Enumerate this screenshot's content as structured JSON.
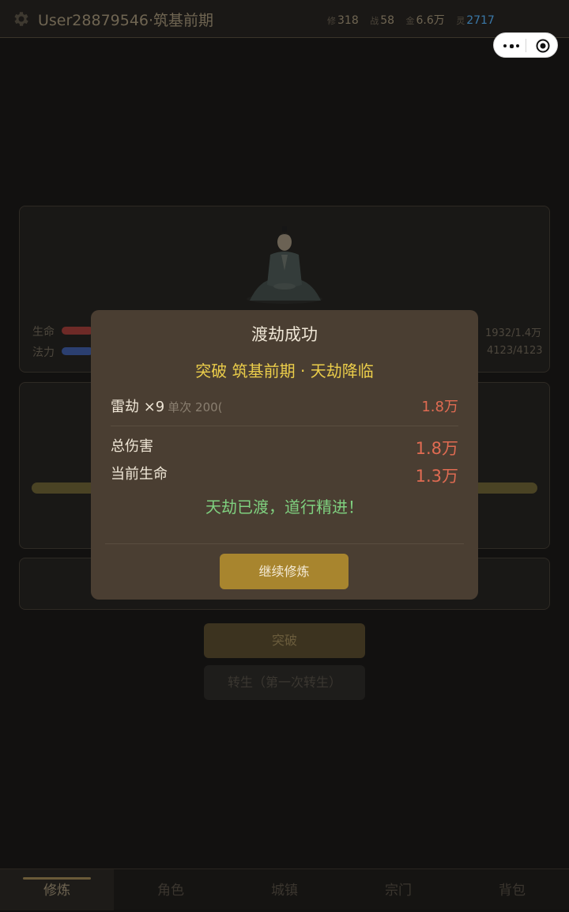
{
  "header": {
    "title": "User28879546·筑基前期",
    "stats": [
      {
        "key": "修",
        "value": "318",
        "color": "#6f6552"
      },
      {
        "key": "战",
        "value": "58",
        "color": "#6f6552"
      },
      {
        "key": "金",
        "value": "6.6万",
        "color": "#6f6552"
      },
      {
        "key": "灵",
        "value": "2717",
        "color": "#3a78a8"
      }
    ]
  },
  "capsule": {
    "menu_icon": "more-dots-icon",
    "close_icon": "record-target-icon"
  },
  "status": {
    "hp_label": "生命",
    "hp_value": "1932/1.4万",
    "hp_color": "#b8403c",
    "hp_level": 0.14,
    "mp_label": "法力",
    "mp_value": "4123/4123",
    "mp_color": "#3d5fb8",
    "mp_level": 1.0
  },
  "actions": {
    "breakthrough_label": "突破",
    "reborn_label": "转生（第一次转生）"
  },
  "modal": {
    "title": "渡劫成功",
    "subtitle": "突破 筑基前期 · 天劫降临",
    "strike_label": "雷劫 ×9",
    "strike_detail": "单次 200(",
    "strike_value": "1.8万",
    "total_label": "总伤害",
    "total_value": "1.8万",
    "hp_label": "当前生命",
    "hp_value": "1.3万",
    "success_text": "天劫已渡，道行精进！",
    "continue_label": "继续修炼"
  },
  "tabs": [
    {
      "label": "修炼",
      "active": true
    },
    {
      "label": "角色",
      "active": false
    },
    {
      "label": "城镇",
      "active": false
    },
    {
      "label": "宗门",
      "active": false
    },
    {
      "label": "背包",
      "active": false
    }
  ]
}
